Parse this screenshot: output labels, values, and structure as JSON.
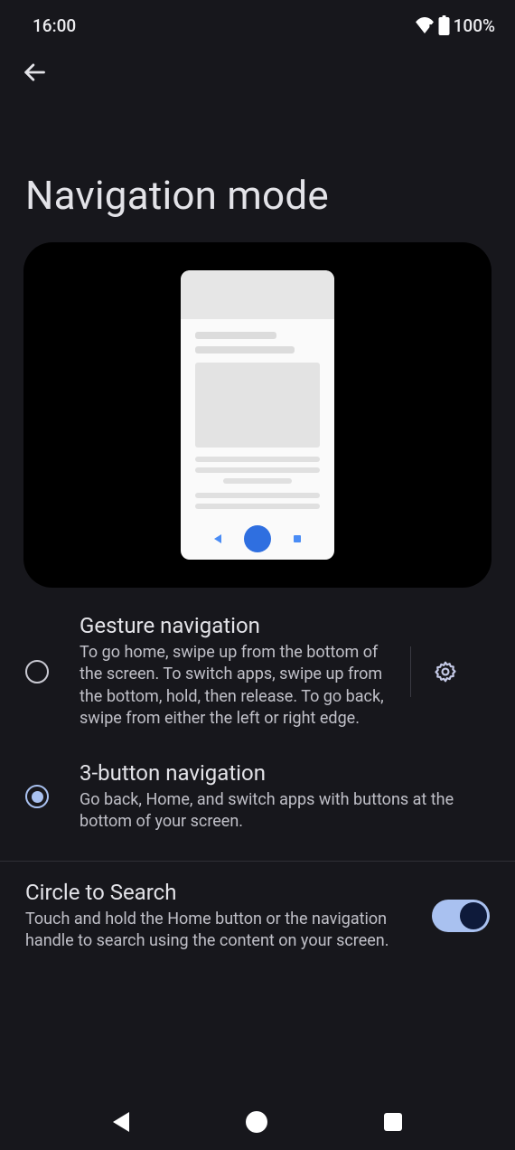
{
  "status": {
    "time": "16:00",
    "battery": "100%"
  },
  "page": {
    "title": "Navigation mode"
  },
  "options": {
    "gesture": {
      "title": "Gesture navigation",
      "desc": "To go home, swipe up from the bottom of the screen. To switch apps, swipe up from the bottom, hold, then release. To go back, swipe from either the left or right edge.",
      "selected": false
    },
    "three_button": {
      "title": "3-button navigation",
      "desc": "Go back, Home, and switch apps with buttons at the bottom of your screen.",
      "selected": true
    }
  },
  "circle_search": {
    "title": "Circle to Search",
    "desc": "Touch and hold the Home button or the navigation handle to search using the content on your screen.",
    "enabled": true
  }
}
